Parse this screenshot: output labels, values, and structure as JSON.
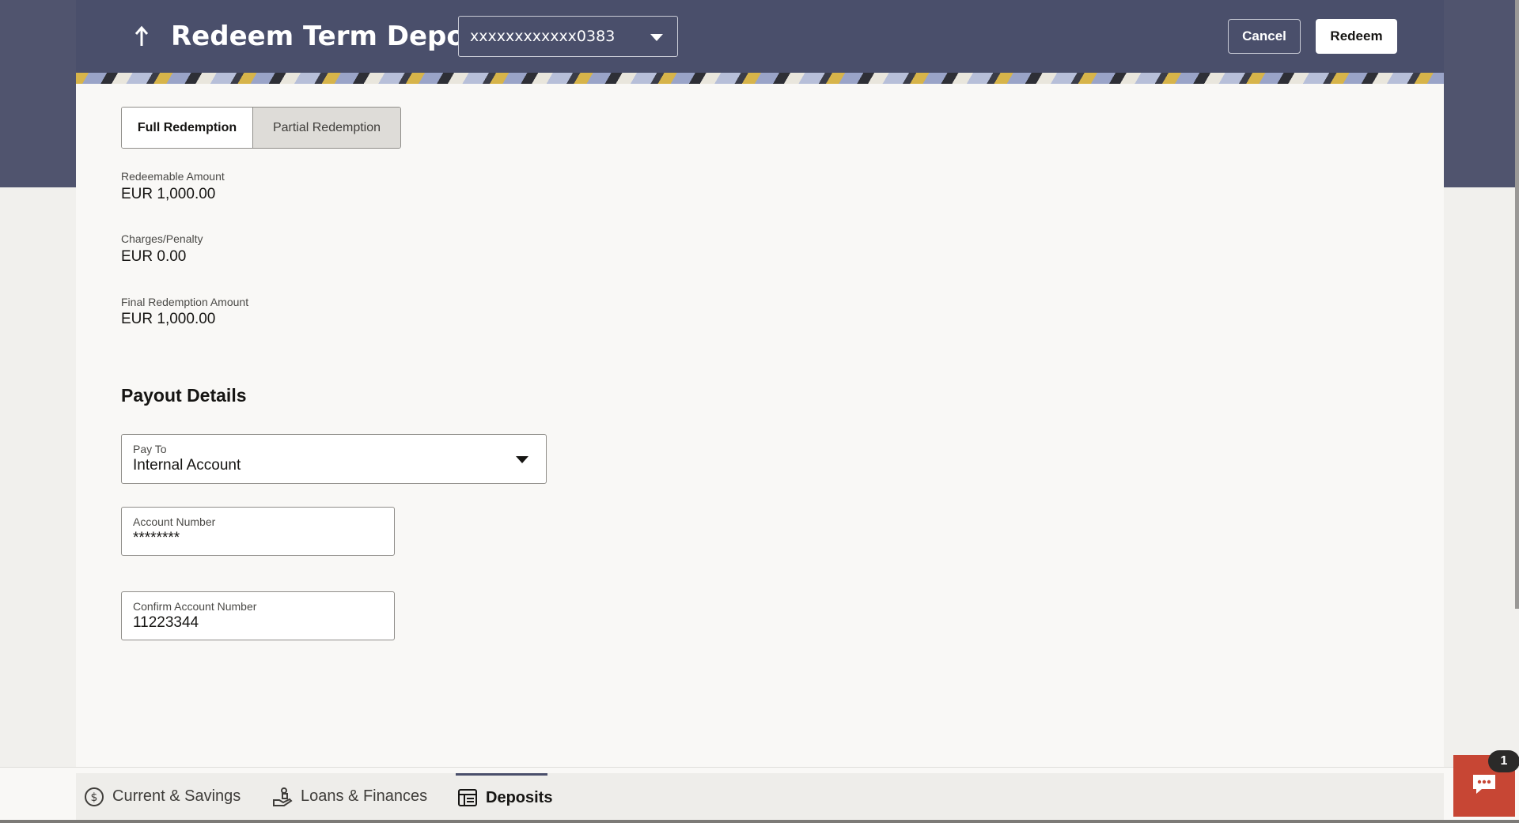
{
  "header": {
    "title": "Redeem Term Deposit",
    "account_selected": "xxxxxxxxxxxx0383",
    "cancel_label": "Cancel",
    "redeem_label": "Redeem"
  },
  "redemption_toggle": {
    "options": [
      "Full Redemption",
      "Partial Redemption"
    ],
    "selected": "Full Redemption"
  },
  "summary": {
    "redeemable_amount_label": "Redeemable Amount",
    "redeemable_amount": "EUR 1,000.00",
    "charges_label": "Charges/Penalty",
    "charges": "EUR 0.00",
    "final_amount_label": "Final Redemption Amount",
    "final_amount": "EUR 1,000.00"
  },
  "payout": {
    "section_title": "Payout Details",
    "pay_to_label": "Pay To",
    "pay_to_value": "Internal Account",
    "account_number_label": "Account Number",
    "account_number_value": "********",
    "confirm_account_label": "Confirm Account Number",
    "confirm_account_value": "11223344"
  },
  "bottom_tabs": [
    {
      "label": "Current & Savings",
      "icon": "dollar-circle-icon",
      "active": false
    },
    {
      "label": "Loans & Finances",
      "icon": "hand-coins-icon",
      "active": false
    },
    {
      "label": "Deposits",
      "icon": "deposits-icon",
      "active": true
    }
  ],
  "chat": {
    "badge_count": "1",
    "icon": "chat-bubble-icon"
  },
  "colors": {
    "header_bg": "#4a4f6b",
    "accent_red": "#c74634",
    "panel_bg": "#f9f8f6"
  }
}
